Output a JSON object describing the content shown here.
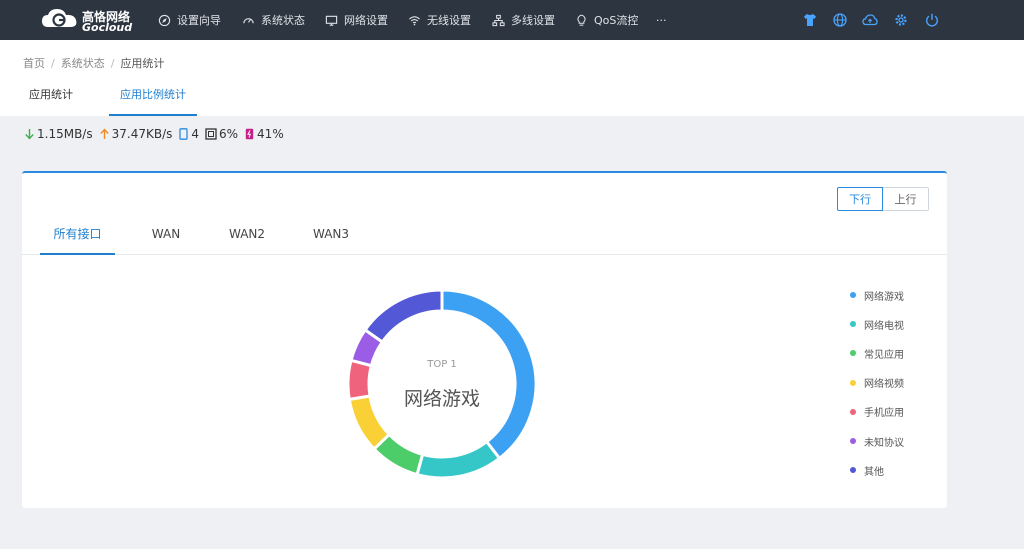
{
  "brand": {
    "name_cn": "高恪网络",
    "name_en": "Gocloud"
  },
  "nav": {
    "items": [
      {
        "label": "设置向导",
        "icon": "compass-icon"
      },
      {
        "label": "系统状态",
        "icon": "dashboard-icon"
      },
      {
        "label": "网络设置",
        "icon": "monitor-icon"
      },
      {
        "label": "无线设置",
        "icon": "wifi-icon"
      },
      {
        "label": "多线设置",
        "icon": "network-icon"
      },
      {
        "label": "QoS流控",
        "icon": "bulb-icon"
      },
      {
        "label": "···",
        "icon": ""
      }
    ],
    "right_icons": [
      "shirt-icon",
      "globe-icon",
      "cloud-upload-icon",
      "gear-icon",
      "power-icon"
    ]
  },
  "breadcrumb": {
    "items": [
      "首页",
      "系统状态",
      "应用统计"
    ],
    "separator": "/"
  },
  "page_tabs": [
    {
      "label": "应用统计",
      "active": false
    },
    {
      "label": "应用比例统计",
      "active": true
    }
  ],
  "stats": {
    "download": "1.15MB/s",
    "upload": "37.47KB/s",
    "devices": "4",
    "cpu": "6%",
    "memory": "41%"
  },
  "direction": {
    "down_label": "下行",
    "up_label": "上行",
    "active": "down"
  },
  "interface_tabs": [
    {
      "label": "所有接口",
      "active": true
    },
    {
      "label": "WAN",
      "active": false
    },
    {
      "label": "WAN2",
      "active": false
    },
    {
      "label": "WAN3",
      "active": false
    }
  ],
  "chart_center": {
    "caption": "TOP 1",
    "value": "网络游戏"
  },
  "chart_data": {
    "type": "pie",
    "categories": [
      "网络游戏",
      "网络电视",
      "常见应用",
      "网络视频",
      "手机应用",
      "未知协议",
      "其他"
    ],
    "values": [
      41.5,
      15.5,
      9,
      10,
      7,
      6,
      16
    ],
    "unit": "%",
    "colors": [
      "#3ca0f3",
      "#35c7c8",
      "#4dcc6a",
      "#fad037",
      "#f0637c",
      "#9b5de5",
      "#5358d6"
    ],
    "legend": "right",
    "style": "donut"
  },
  "colors": {
    "accent": "#2b8ae0",
    "topbar": "#2d3640",
    "icon_blue": "#4aa3ff"
  }
}
